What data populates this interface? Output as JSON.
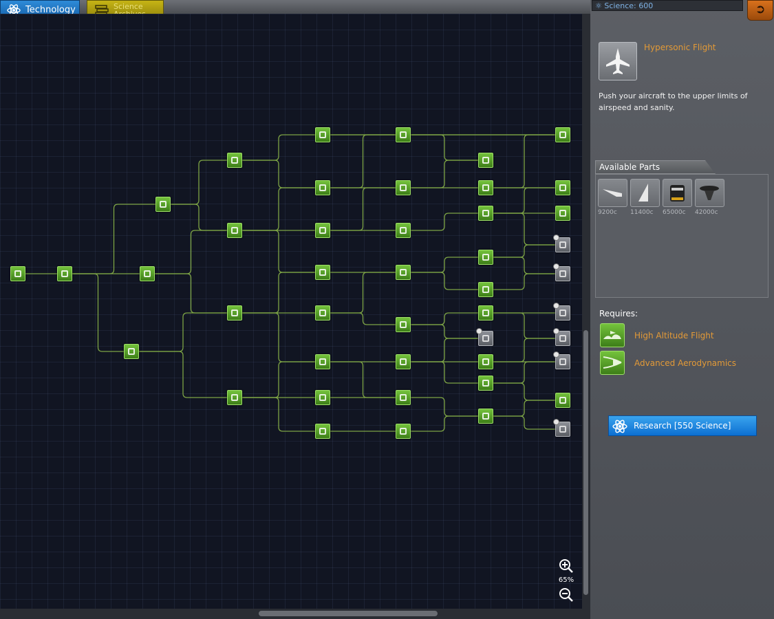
{
  "tabs": {
    "technology": "Technology",
    "archives_line1": "Science",
    "archives_line2": "Archives"
  },
  "science": {
    "label": "Science: 600"
  },
  "zoom": {
    "level": "65%"
  },
  "selected_tech": {
    "title": "Hypersonic Flight",
    "description": "Push your aircraft to the upper limits of airspeed and sanity.",
    "icon": "jet-aircraft-icon"
  },
  "available_parts": {
    "header": "Available Parts",
    "items": [
      {
        "cost": "9200c",
        "icon": "wing-strake-icon"
      },
      {
        "cost": "11400c",
        "icon": "delta-wing-icon"
      },
      {
        "cost": "65000c",
        "icon": "engine-icon"
      },
      {
        "cost": "42000c",
        "icon": "air-intake-icon"
      }
    ]
  },
  "requires": {
    "label": "Requires:",
    "items": [
      {
        "name": "High Altitude Flight",
        "icon": "high-altitude-icon"
      },
      {
        "name": "Advanced Aerodynamics",
        "icon": "aerodynamics-icon"
      }
    ]
  },
  "research_button": {
    "label": "Research [550 Science]"
  },
  "colors": {
    "researched": "#5aa72a",
    "locked": "#7a7d83",
    "accent_orange": "#e39a37",
    "link": "#7ea545"
  }
}
